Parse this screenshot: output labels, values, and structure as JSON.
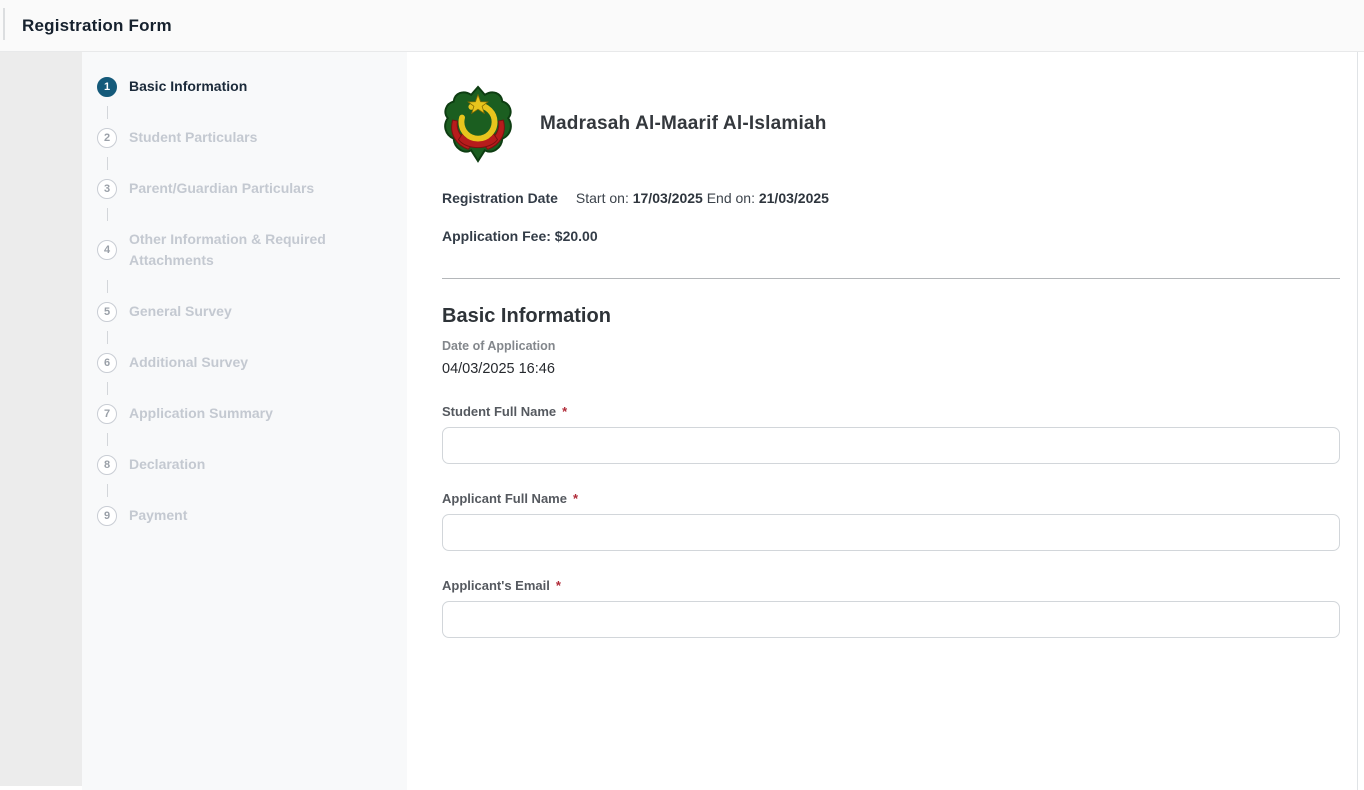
{
  "header": {
    "title": "Registration Form"
  },
  "stepper": {
    "steps": [
      {
        "number": "1",
        "label": "Basic Information",
        "active": true
      },
      {
        "number": "2",
        "label": "Student Particulars",
        "active": false
      },
      {
        "number": "3",
        "label": "Parent/Guardian Particulars",
        "active": false
      },
      {
        "number": "4",
        "label": "Other Information & Required Attachments",
        "active": false
      },
      {
        "number": "5",
        "label": "General Survey",
        "active": false
      },
      {
        "number": "6",
        "label": "Additional Survey",
        "active": false
      },
      {
        "number": "7",
        "label": "Application Summary",
        "active": false
      },
      {
        "number": "8",
        "label": "Declaration",
        "active": false
      },
      {
        "number": "9",
        "label": "Payment",
        "active": false
      }
    ]
  },
  "school": {
    "name": "Madrasah Al-Maarif Al-Islamiah",
    "logo_icon": "school-crest-icon",
    "logo_colors": {
      "green": "#1b5e20",
      "outline": "#0e3d12",
      "gold": "#e8c51d",
      "red": "#b71c1c"
    }
  },
  "registration": {
    "date_label": "Registration Date",
    "start_label": "Start on:",
    "start_date": "17/03/2025",
    "end_label": "End on:",
    "end_date": "21/03/2025",
    "fee_label": "Application Fee:",
    "fee_value": "$20.00"
  },
  "form": {
    "section_title": "Basic Information",
    "date_of_application": {
      "label": "Date of Application",
      "value": "04/03/2025 16:46"
    },
    "fields": [
      {
        "label": "Student Full Name",
        "required": "*",
        "value": ""
      },
      {
        "label": "Applicant Full Name",
        "required": "*",
        "value": ""
      },
      {
        "label": "Applicant's Email",
        "required": "*",
        "value": ""
      }
    ]
  },
  "colors": {
    "active_step": "#155a7a",
    "topbar_bg": "#fafafa",
    "left_rail_bg": "#ececec",
    "stepper_bg": "#f8f9fa",
    "required_asterisk": "#b02a37",
    "input_border": "#d2d6da"
  }
}
